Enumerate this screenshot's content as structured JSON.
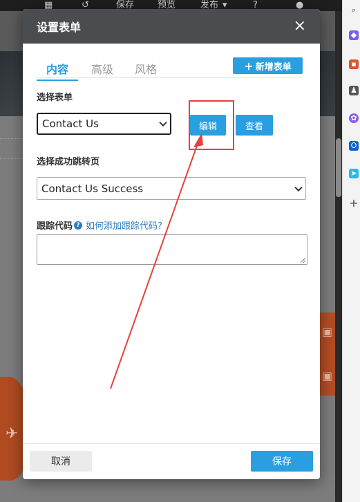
{
  "background_toolbar": {
    "save": "保存",
    "preview": "预览",
    "publish": "发布"
  },
  "modal": {
    "title": "设置表单",
    "tabs": [
      {
        "label": "内容",
        "active": true
      },
      {
        "label": "高级",
        "active": false
      },
      {
        "label": "风格",
        "active": false
      }
    ],
    "new_form_button": "新增表单",
    "select_form_label": "选择表单",
    "select_form_value": "Contact Us",
    "edit_button": "编辑",
    "view_button": "查看",
    "success_page_label": "选择成功跳转页",
    "success_page_value": "Contact Us Success",
    "tracking_code_label": "跟踪代码",
    "tracking_help_link": "如何添加跟踪代码?",
    "tracking_code_value": "",
    "cancel_button": "取消",
    "save_button": "保存"
  },
  "colors": {
    "accent": "#2a9fe0",
    "header_bg": "#4a4c50",
    "annotation_red": "#e8403a"
  }
}
